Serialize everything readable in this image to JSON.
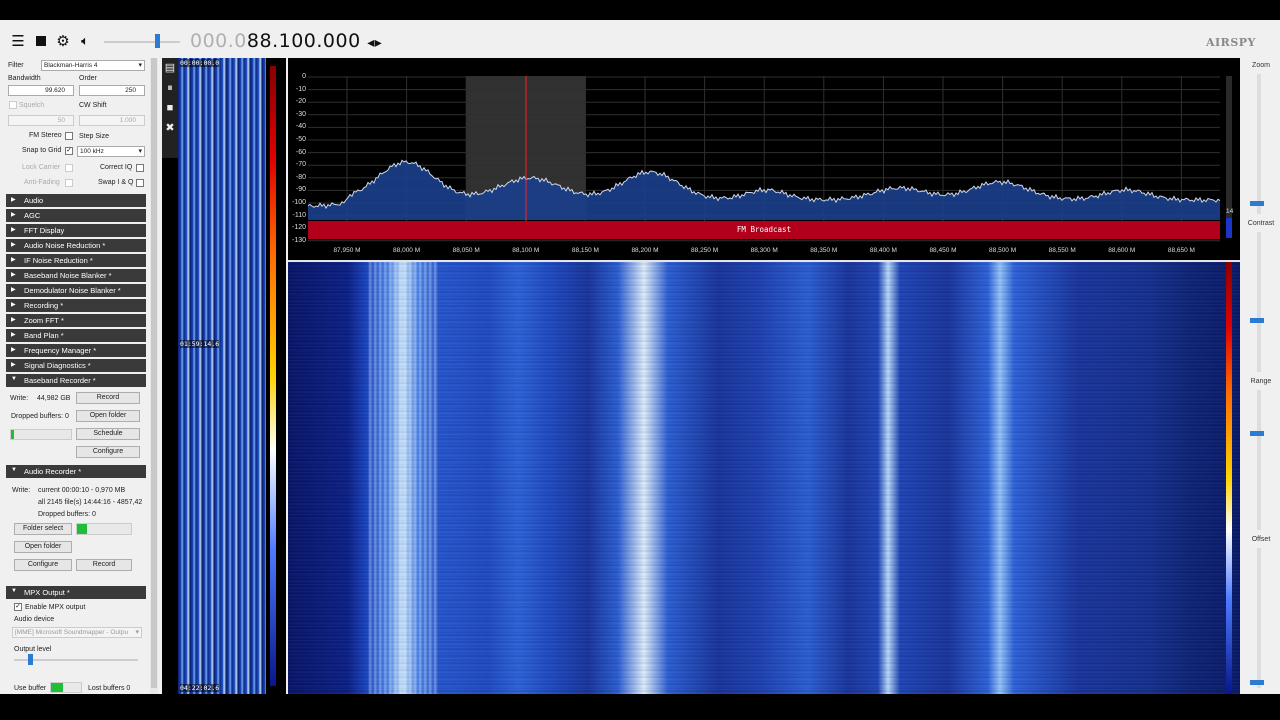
{
  "toolbar": {
    "freq_prefix": "000.0",
    "freq_main": "88.100.000",
    "freq_arrows": "◂▸",
    "logo": "AIRSPY"
  },
  "filter": {
    "filter_label": "Filter",
    "filter_value": "Blackman-Harris 4",
    "bandwidth_label": "Bandwidth",
    "bandwidth_value": "99.620",
    "order_label": "Order",
    "order_value": "250",
    "squelch_label": "Squelch",
    "squelch_value": "50",
    "cwshift_label": "CW Shift",
    "cwshift_value": "1.000",
    "fmstereo_label": "FM Stereo",
    "stepsize_label": "Step Size",
    "snapgrid_label": "Snap to Grid",
    "stepsize_value": "100 kHz",
    "lockcarrier_label": "Lock Carrier",
    "correctiq_label": "Correct IQ",
    "antifading_label": "Anti-Fading",
    "swapiq_label": "Swap I & Q"
  },
  "sections": [
    "Audio",
    "AGC",
    "FFT Display",
    "Audio Noise Reduction *",
    "IF Noise Reduction *",
    "Baseband Noise Blanker *",
    "Demodulator Noise Blanker *",
    "Recording *",
    "Zoom FFT *",
    "Band Plan *",
    "Frequency Manager *",
    "Signal Diagnostics *",
    "Baseband Recorder *"
  ],
  "baseband": {
    "write_label": "Write:",
    "write_value": "44,982 GB",
    "record_btn": "Record",
    "dropped_label": "Dropped buffers: 0",
    "openfolder_btn": "Open folder",
    "schedule_btn": "Schedule",
    "configure_btn": "Configure"
  },
  "audio_recorder": {
    "title": "Audio Recorder *",
    "write_label": "Write:",
    "current": "current 00:00:10 - 0,970 MB",
    "all": "all 2145 file(s) 14:44:16 - 4857,42",
    "dropped": "Dropped buffers: 0",
    "folderselect_btn": "Folder select",
    "openfolder_btn": "Open folder",
    "configure_btn": "Configure",
    "record_btn": "Record"
  },
  "mpx": {
    "title": "MPX Output *",
    "enable_label": "Enable MPX output",
    "device_label": "Audio device",
    "device_value": "[MME] Microsoft Soundmapper - Outpu",
    "level_label": "Output level",
    "usebuffer_label": "Use buffer",
    "lostbuffers_label": "Lost buffers 0"
  },
  "mini_waterfall": {
    "ts1": "00:00:00.0",
    "ts2": "01:59:14.6",
    "ts3": "04:22:02.6"
  },
  "spectrum": {
    "y_ticks": [
      "0",
      "-10",
      "-20",
      "-30",
      "-40",
      "-50",
      "-60",
      "-70",
      "-80",
      "-90",
      "-100",
      "-110",
      "-120",
      "-130"
    ],
    "x_ticks": [
      "87,950 M",
      "88,000 M",
      "88,050 M",
      "88,100 M",
      "88,150 M",
      "88,200 M",
      "88,250 M",
      "88,300 M",
      "88,350 M",
      "88,400 M",
      "88,450 M",
      "88,500 M",
      "88,550 M",
      "88,600 M",
      "88,650 M"
    ],
    "band_label": "FM Broadcast",
    "side_value": "14"
  },
  "right_panel": {
    "zoom": "Zoom",
    "contrast": "Contrast",
    "range": "Range",
    "offset": "Offset"
  },
  "colors": {
    "band": "#b2001c",
    "accent": "#2a7bd1",
    "spectrum_fill": "#1b3f8c",
    "waterfall_base": "#06146a"
  }
}
